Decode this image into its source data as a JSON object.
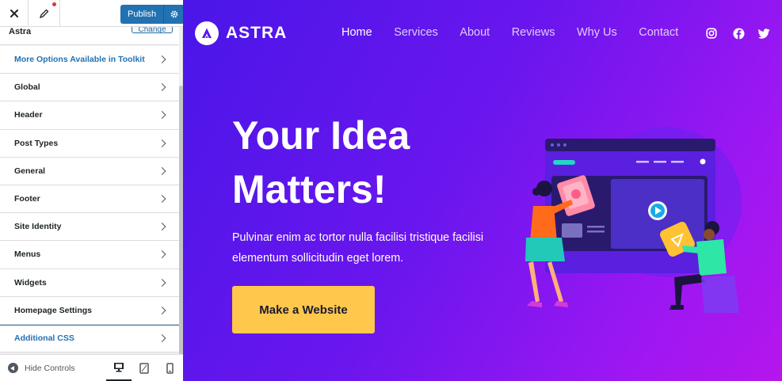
{
  "sidebar": {
    "topbar": {
      "publish_label": "Publish"
    },
    "theme": {
      "name": "Astra",
      "change_label": "Change"
    },
    "menu": [
      {
        "label": "More Options Available in Toolkit"
      },
      {
        "label": "Global"
      },
      {
        "label": "Header"
      },
      {
        "label": "Post Types"
      },
      {
        "label": "General"
      },
      {
        "label": "Footer"
      },
      {
        "label": "Site Identity"
      },
      {
        "label": "Menus"
      },
      {
        "label": "Widgets"
      },
      {
        "label": "Homepage Settings"
      },
      {
        "label": "Additional CSS"
      }
    ],
    "footer": {
      "hide_label": "Hide Controls"
    }
  },
  "site": {
    "logo_text": "ASTRA",
    "nav": [
      {
        "label": "Home"
      },
      {
        "label": "Services"
      },
      {
        "label": "About"
      },
      {
        "label": "Reviews"
      },
      {
        "label": "Why Us"
      },
      {
        "label": "Contact"
      }
    ],
    "social_icons": [
      "instagram-icon",
      "facebook-icon",
      "twitter-icon"
    ],
    "hero": {
      "title": "Your Idea Matters!",
      "text": "Pulvinar enim ac tortor nulla facilisi tristique facilisi elementum sollicitudin eget lorem.",
      "cta_label": "Make a Website"
    }
  },
  "colors": {
    "wp_blue": "#2271b1",
    "cta_yellow": "#ffc74c",
    "hero_gradient_start": "#4a16e8",
    "hero_gradient_end": "#b516ec"
  }
}
